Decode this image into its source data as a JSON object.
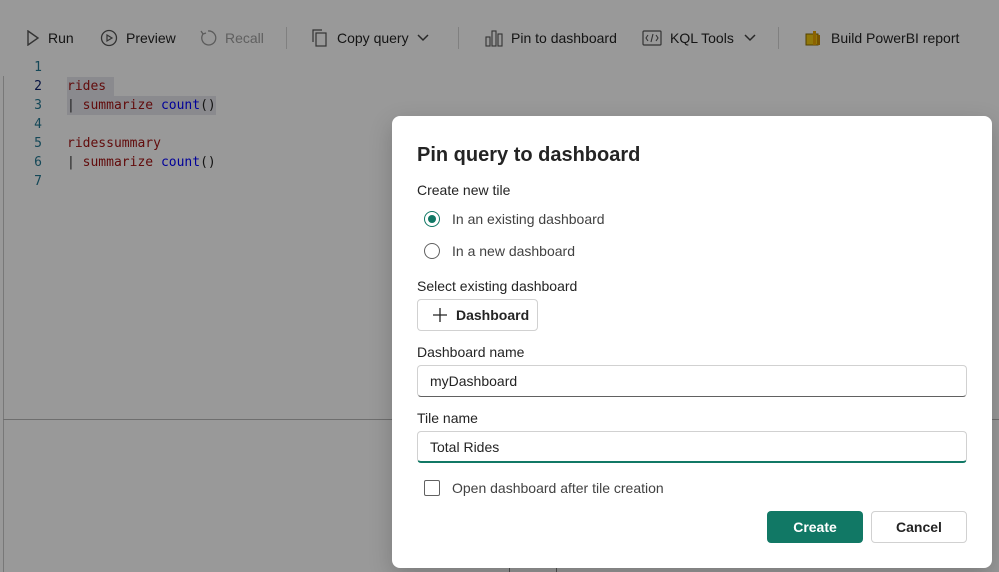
{
  "toolbar": {
    "run_label": "Run",
    "preview_label": "Preview",
    "recall_label": "Recall",
    "copy_query_label": "Copy query",
    "pin_label": "Pin to dashboard",
    "kql_tools_label": "KQL Tools",
    "powerbi_label": "Build PowerBI report"
  },
  "editor": {
    "lines": [
      {
        "number": "1",
        "table": "",
        "pipe": "",
        "op": "",
        "fn": "",
        "rest": ""
      },
      {
        "number": "2",
        "table": "rides"
      },
      {
        "number": "3",
        "pipe": "| ",
        "op": "summarize",
        "fn": "count",
        "rest": "()"
      },
      {
        "number": "4"
      },
      {
        "number": "5",
        "table": "ridessummary"
      },
      {
        "number": "6",
        "pipe": "| ",
        "op": "summarize",
        "fn": "count",
        "rest": "()"
      },
      {
        "number": "7"
      }
    ]
  },
  "dialog": {
    "title": "Pin query to dashboard",
    "create_new_tile_label": "Create new tile",
    "option_existing": "In an existing dashboard",
    "option_new": "In a new dashboard",
    "selected_option": "existing",
    "select_existing_label": "Select existing dashboard",
    "dashboard_button_label": "Dashboard",
    "dashboard_name_label": "Dashboard name",
    "dashboard_name_value": "myDashboard",
    "tile_name_label": "Tile name",
    "tile_name_value": "Total Rides",
    "open_after_label": "Open dashboard after tile creation",
    "open_after_checked": false,
    "create_label": "Create",
    "cancel_label": "Cancel"
  },
  "colors": {
    "accent": "#117865",
    "overlay": "rgba(0,0,0,0.4)"
  }
}
